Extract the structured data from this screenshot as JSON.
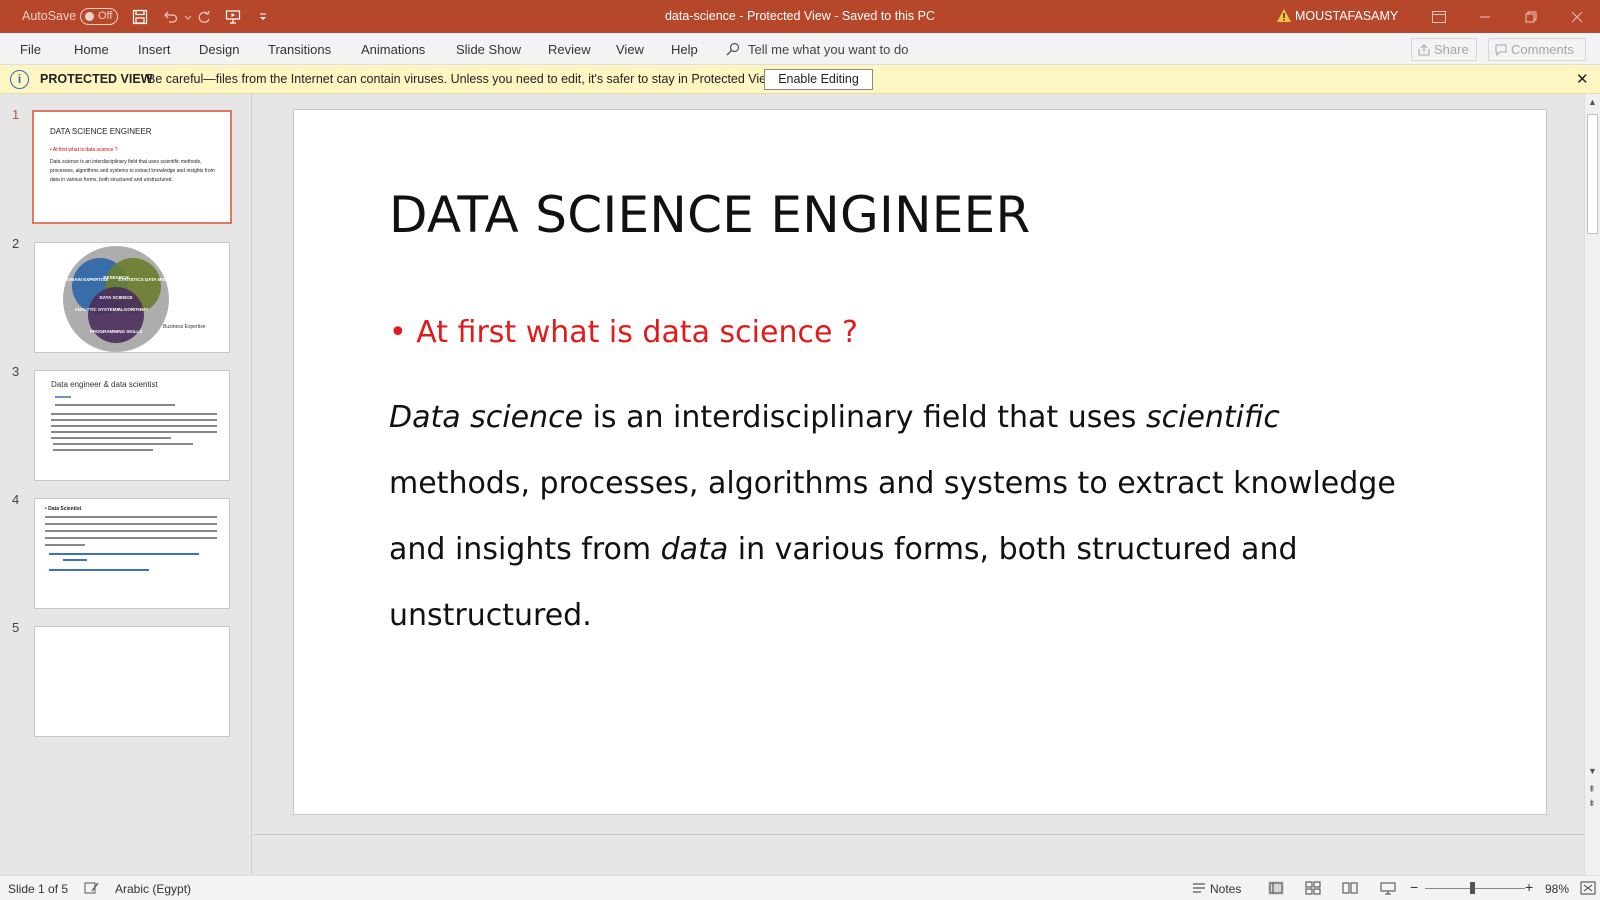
{
  "titlebar": {
    "autosave_label": "AutoSave",
    "autosave_state": "Off",
    "doc_title": "data-science  -  Protected View  -  Saved to this PC",
    "user_name": "MOUSTAFASAMY",
    "bg_color": "#b7472a"
  },
  "menu": {
    "items": [
      "File",
      "Home",
      "Insert",
      "Design",
      "Transitions",
      "Animations",
      "Slide Show",
      "Review",
      "View",
      "Help"
    ],
    "tell_me": "Tell me what you want to do",
    "share": "Share",
    "comments": "Comments"
  },
  "protected_view": {
    "title": "PROTECTED VIEW",
    "message": "Be careful—files from the Internet can contain viruses. Unless you need to edit, it's safer to stay in Protected View.",
    "enable_button": "Enable Editing"
  },
  "thumbnails": {
    "numbers": [
      "1",
      "2",
      "3",
      "4",
      "5"
    ],
    "slide1_title": "DATA SCIENCE ENGINEER",
    "slide1_bullet": "• At first what is data science ?",
    "slide1_body": "Data science is an interdisciplinary field that uses scientific methods, processes, algorithms and systems to extract knowledge and insights from data in various forms, both structured and unstructured.",
    "slide2_labels": {
      "domain": "DOMAIN EXPERTISE",
      "research": "RESEARCH",
      "statistics": "STATISTICS DATA MINING",
      "data_science": "DATA SCIENCE",
      "analytic": "ANALYTIC SYSTEMS",
      "algorithms": "ALGORITHMS",
      "programming": "PROGRAMMING SKILLS",
      "business": "Business Expertise"
    },
    "slide3_title": "Data engineer & data scientist",
    "slide4_heading": "• Data Scientist"
  },
  "slide": {
    "title": "DATA SCIENCE ENGINEER",
    "bullet_mark": "•",
    "bullet_text": "At first what is data science ?",
    "body": {
      "term1": "Data science",
      "part1": " is an interdisciplinary field that uses ",
      "term2": "scientific",
      "part2": " methods, processes, algorithms and systems to extract knowledge and insights from ",
      "term3": "data",
      "part3": " in various forms, both structured and unstructured."
    },
    "bullet_color": "#e31a1a"
  },
  "status": {
    "slide_counter": "Slide 1 of 5",
    "language": "Arabic (Egypt)",
    "notes": "Notes",
    "zoom": "98%"
  }
}
